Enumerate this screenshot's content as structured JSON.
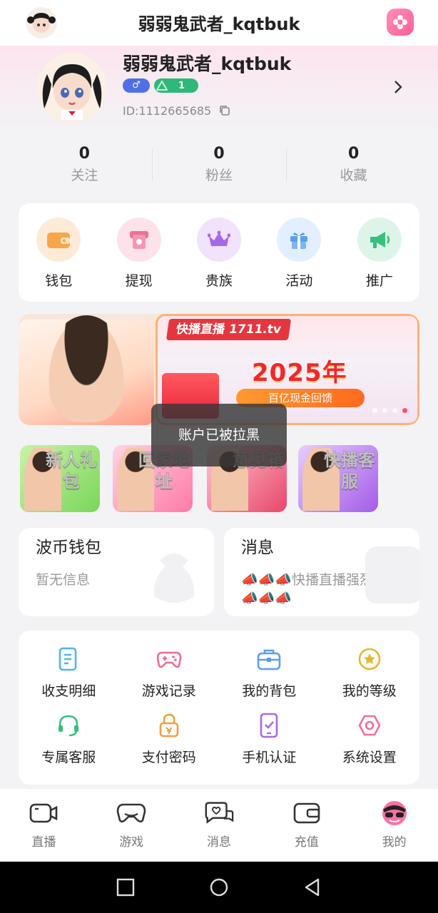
{
  "header": {
    "title": "弱弱鬼武者_kqtbuk"
  },
  "profile": {
    "name": "弱弱鬼武者_kqtbuk",
    "gender_symbol": "♂",
    "level": "1",
    "id_text": "ID:1112665685"
  },
  "stats": [
    {
      "value": "0",
      "label": "关注"
    },
    {
      "value": "0",
      "label": "粉丝"
    },
    {
      "value": "0",
      "label": "收藏"
    }
  ],
  "quick_actions": [
    {
      "label": "钱包",
      "icon": "wallet-icon",
      "color": "#f7a64a"
    },
    {
      "label": "提现",
      "icon": "withdraw-icon",
      "color": "#f0709a"
    },
    {
      "label": "贵族",
      "icon": "crown-icon",
      "color": "#a56be6"
    },
    {
      "label": "活动",
      "icon": "gift-icon",
      "color": "#5a9ef0"
    },
    {
      "label": "推广",
      "icon": "megaphone-icon",
      "color": "#36c07c"
    }
  ],
  "banner": {
    "brand": "快播直播 1711.tv",
    "year_text": "2025年",
    "sub_text": "百亿现金回馈"
  },
  "toast": {
    "text": "账户已被拉黑"
  },
  "promos": [
    {
      "text": "新人礼包",
      "color": "#6ed04a"
    },
    {
      "text": "回家地址",
      "color": "#ff6a9a"
    },
    {
      "text": "意见箱",
      "color": "#e8466a"
    },
    {
      "text": "快播客服",
      "color": "#a45ce8"
    }
  ],
  "wallet_card": {
    "title": "波币钱包",
    "subtitle": "暂无信息"
  },
  "message_card": {
    "title": "消息",
    "subtitle": "📣📣📣快播直播强烈推荐📣📣📣"
  },
  "tools": [
    {
      "label": "收支明细",
      "icon": "document-icon",
      "color": "#4fb6e6"
    },
    {
      "label": "游戏记录",
      "icon": "gamepad-icon",
      "color": "#ef6a8e"
    },
    {
      "label": "我的背包",
      "icon": "bag-icon",
      "color": "#5a9ef0"
    },
    {
      "label": "我的等级",
      "icon": "star-badge-icon",
      "color": "#e9b52c"
    },
    {
      "label": "专属客服",
      "icon": "headset-icon",
      "color": "#36c07c"
    },
    {
      "label": "支付密码",
      "icon": "lock-icon",
      "color": "#f0a040"
    },
    {
      "label": "手机认证",
      "icon": "phone-check-icon",
      "color": "#a56be6"
    },
    {
      "label": "系统设置",
      "icon": "settings-hexagon-icon",
      "color": "#f0709a"
    }
  ],
  "bottom_nav": [
    {
      "label": "直播",
      "icon": "video-camera-icon"
    },
    {
      "label": "游戏",
      "icon": "gamepad-icon"
    },
    {
      "label": "消息",
      "icon": "chat-heart-icon"
    },
    {
      "label": "充值",
      "icon": "wallet-icon"
    },
    {
      "label": "我的",
      "icon": "avatar-sunglasses-icon"
    }
  ],
  "colors": {
    "accent_pink": "#ff5e98",
    "level_green": "#2fb87a",
    "gender_blue": "#4f6fe6"
  }
}
